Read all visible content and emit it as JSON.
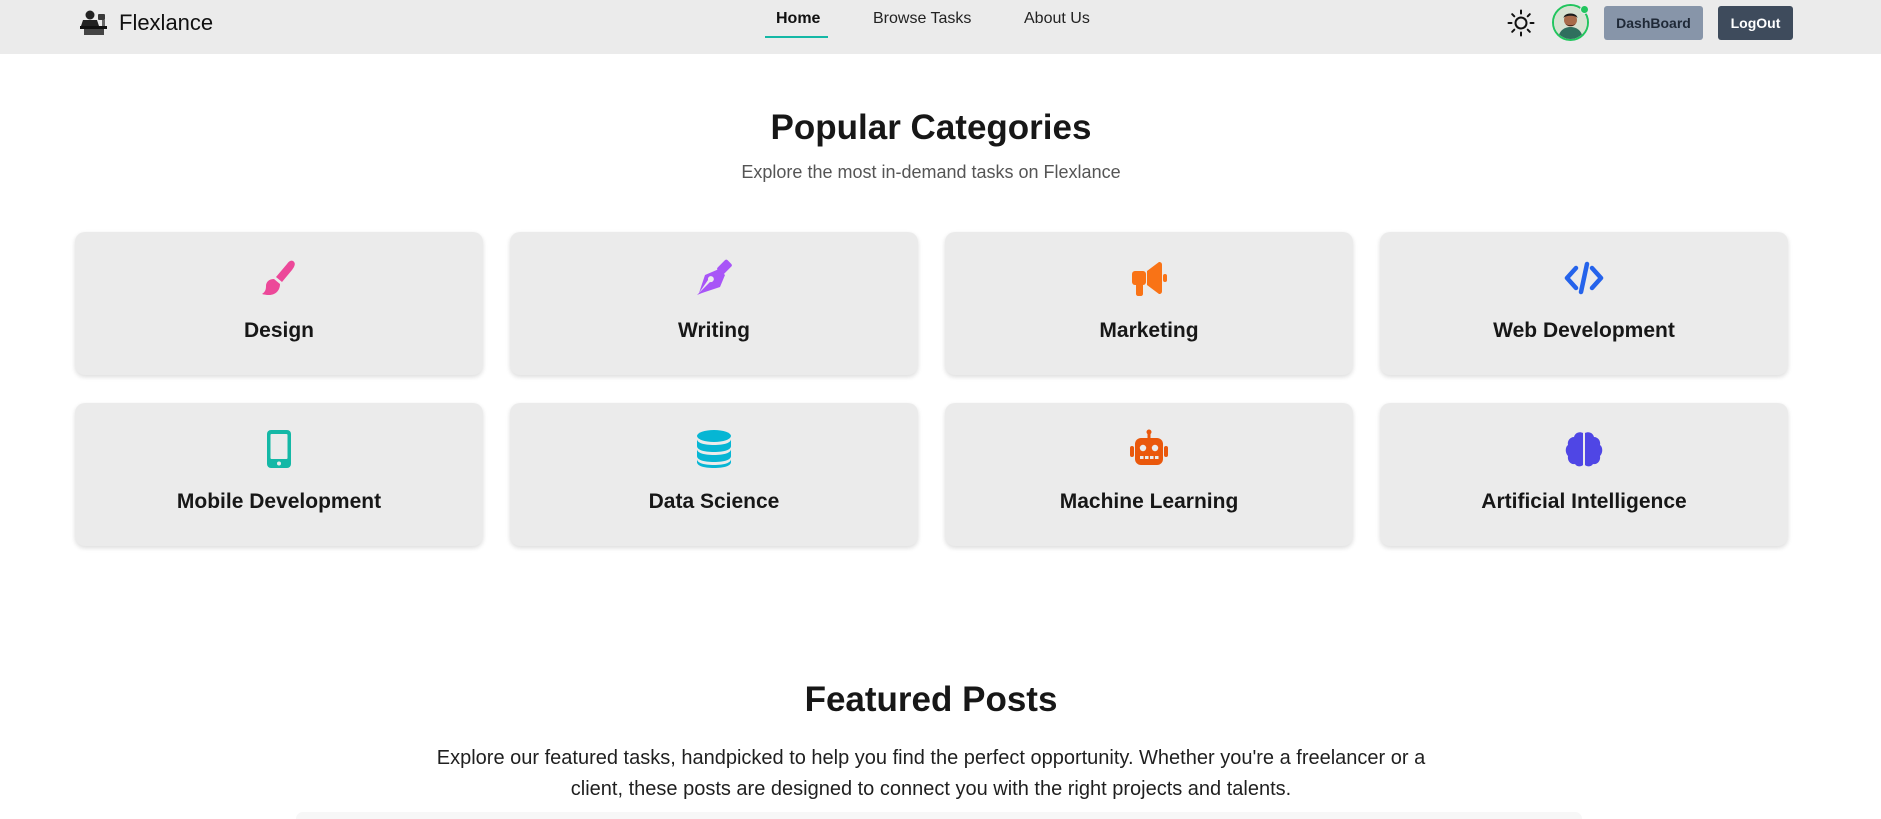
{
  "navbar": {
    "brand_name": "Flexlance",
    "links": [
      {
        "label": "Home",
        "active": true
      },
      {
        "label": "Browse Tasks",
        "active": false
      },
      {
        "label": "About Us",
        "active": false
      }
    ],
    "theme_icon": "sun-icon",
    "dashboard_label": "DashBoard",
    "logout_label": "LogOut"
  },
  "categories": {
    "title": "Popular Categories",
    "subtitle": "Explore the most in-demand tasks on Flexlance",
    "items": [
      {
        "label": "Design",
        "icon": "paintbrush-icon",
        "color": "#ec4899"
      },
      {
        "label": "Writing",
        "icon": "pen-nib-icon",
        "color": "#a855f7"
      },
      {
        "label": "Marketing",
        "icon": "megaphone-icon",
        "color": "#f97316"
      },
      {
        "label": "Web Development",
        "icon": "code-icon",
        "color": "#2563eb"
      },
      {
        "label": "Mobile Development",
        "icon": "mobile-phone-icon",
        "color": "#14b8a6"
      },
      {
        "label": "Data Science",
        "icon": "database-icon",
        "color": "#06b6d4"
      },
      {
        "label": "Machine Learning",
        "icon": "robot-icon",
        "color": "#ea580c"
      },
      {
        "label": "Artificial Intelligence",
        "icon": "brain-icon",
        "color": "#4f46e5"
      }
    ]
  },
  "featured": {
    "title": "Featured Posts",
    "description": "Explore our featured tasks, handpicked to help you find the perfect opportunity. Whether you're a freelancer or a client, these posts are designed to connect you with the right projects and talents."
  },
  "colors": {
    "accent": "#14b8a6",
    "navbar_bg": "#ebebeb",
    "card_bg": "#ebebeb",
    "dashboard_button": "#8795a9",
    "logout_button": "#3e4b5c",
    "online_indicator": "#22c55e"
  }
}
